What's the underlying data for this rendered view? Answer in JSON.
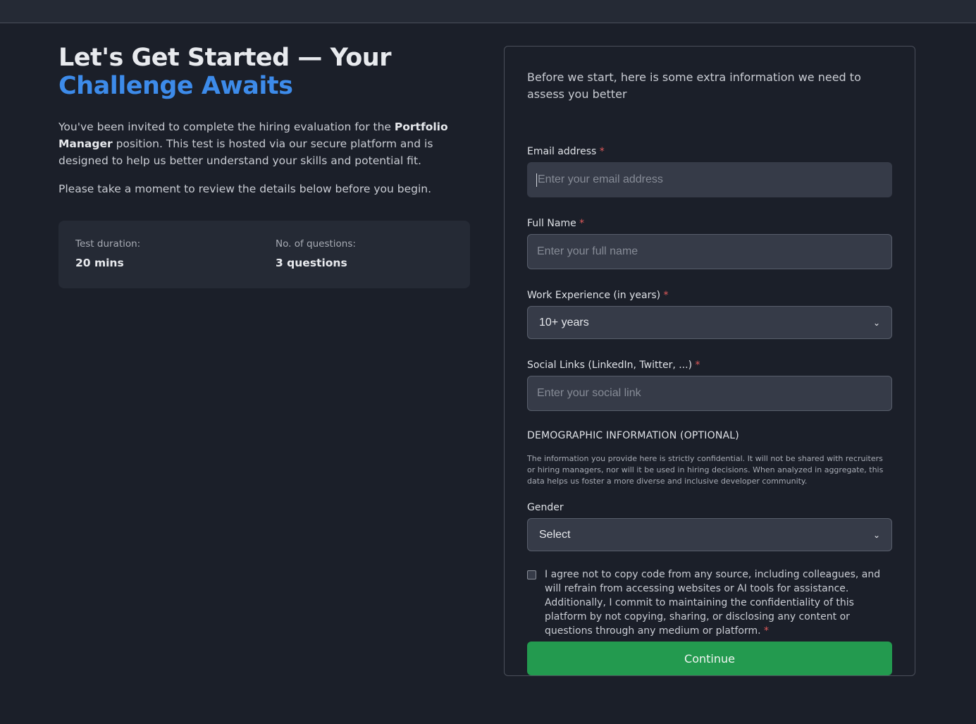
{
  "hero": {
    "title_line1": "Let's Get Started — Your",
    "title_line2": "Challenge Awaits",
    "intro_before": "You've been invited to complete the hiring evaluation for the ",
    "intro_role": "Portfolio Manager",
    "intro_after": " position. This test is hosted via our secure platform and is designed to help us better understand your skills and potential fit.",
    "review_text": "Please take a moment to review the details below before you begin."
  },
  "stats": {
    "duration_label": "Test duration:",
    "duration_value": "20 mins",
    "questions_label": "No. of questions:",
    "questions_value": "3 questions"
  },
  "form": {
    "intro": "Before we start, here is some extra information we need to assess you better",
    "email": {
      "label": "Email address",
      "required": "*",
      "placeholder": "Enter your email address",
      "value": ""
    },
    "full_name": {
      "label": "Full Name",
      "required": "*",
      "placeholder": "Enter your full name",
      "value": ""
    },
    "experience": {
      "label": "Work Experience (in years)",
      "required": "*",
      "selected": "10+ years"
    },
    "social": {
      "label": "Social Links (LinkedIn, Twitter, ...)",
      "required": "*",
      "placeholder": "Enter your social link",
      "value": ""
    },
    "demographic_title": "DEMOGRAPHIC INFORMATION (OPTIONAL)",
    "demographic_note": "The information you provide here is strictly confidential. It will not be shared with recruiters or hiring managers, nor will it be used in hiring decisions. When analyzed in aggregate, this data helps us foster a more diverse and inclusive developer community.",
    "gender": {
      "label": "Gender",
      "selected": "Select"
    },
    "agreement": {
      "text": "I agree not to copy code from any source, including colleagues, and will refrain from accessing websites or AI tools for assistance. Additionally, I commit to maintaining the confidentiality of this platform by not copying, sharing, or disclosing any content or questions through any medium or platform.",
      "required": "*",
      "checked": false
    },
    "continue_label": "Continue"
  },
  "colors": {
    "background": "#1b1f29",
    "accent": "#3d8bea",
    "button": "#239a4f",
    "required": "#e05a5a"
  }
}
